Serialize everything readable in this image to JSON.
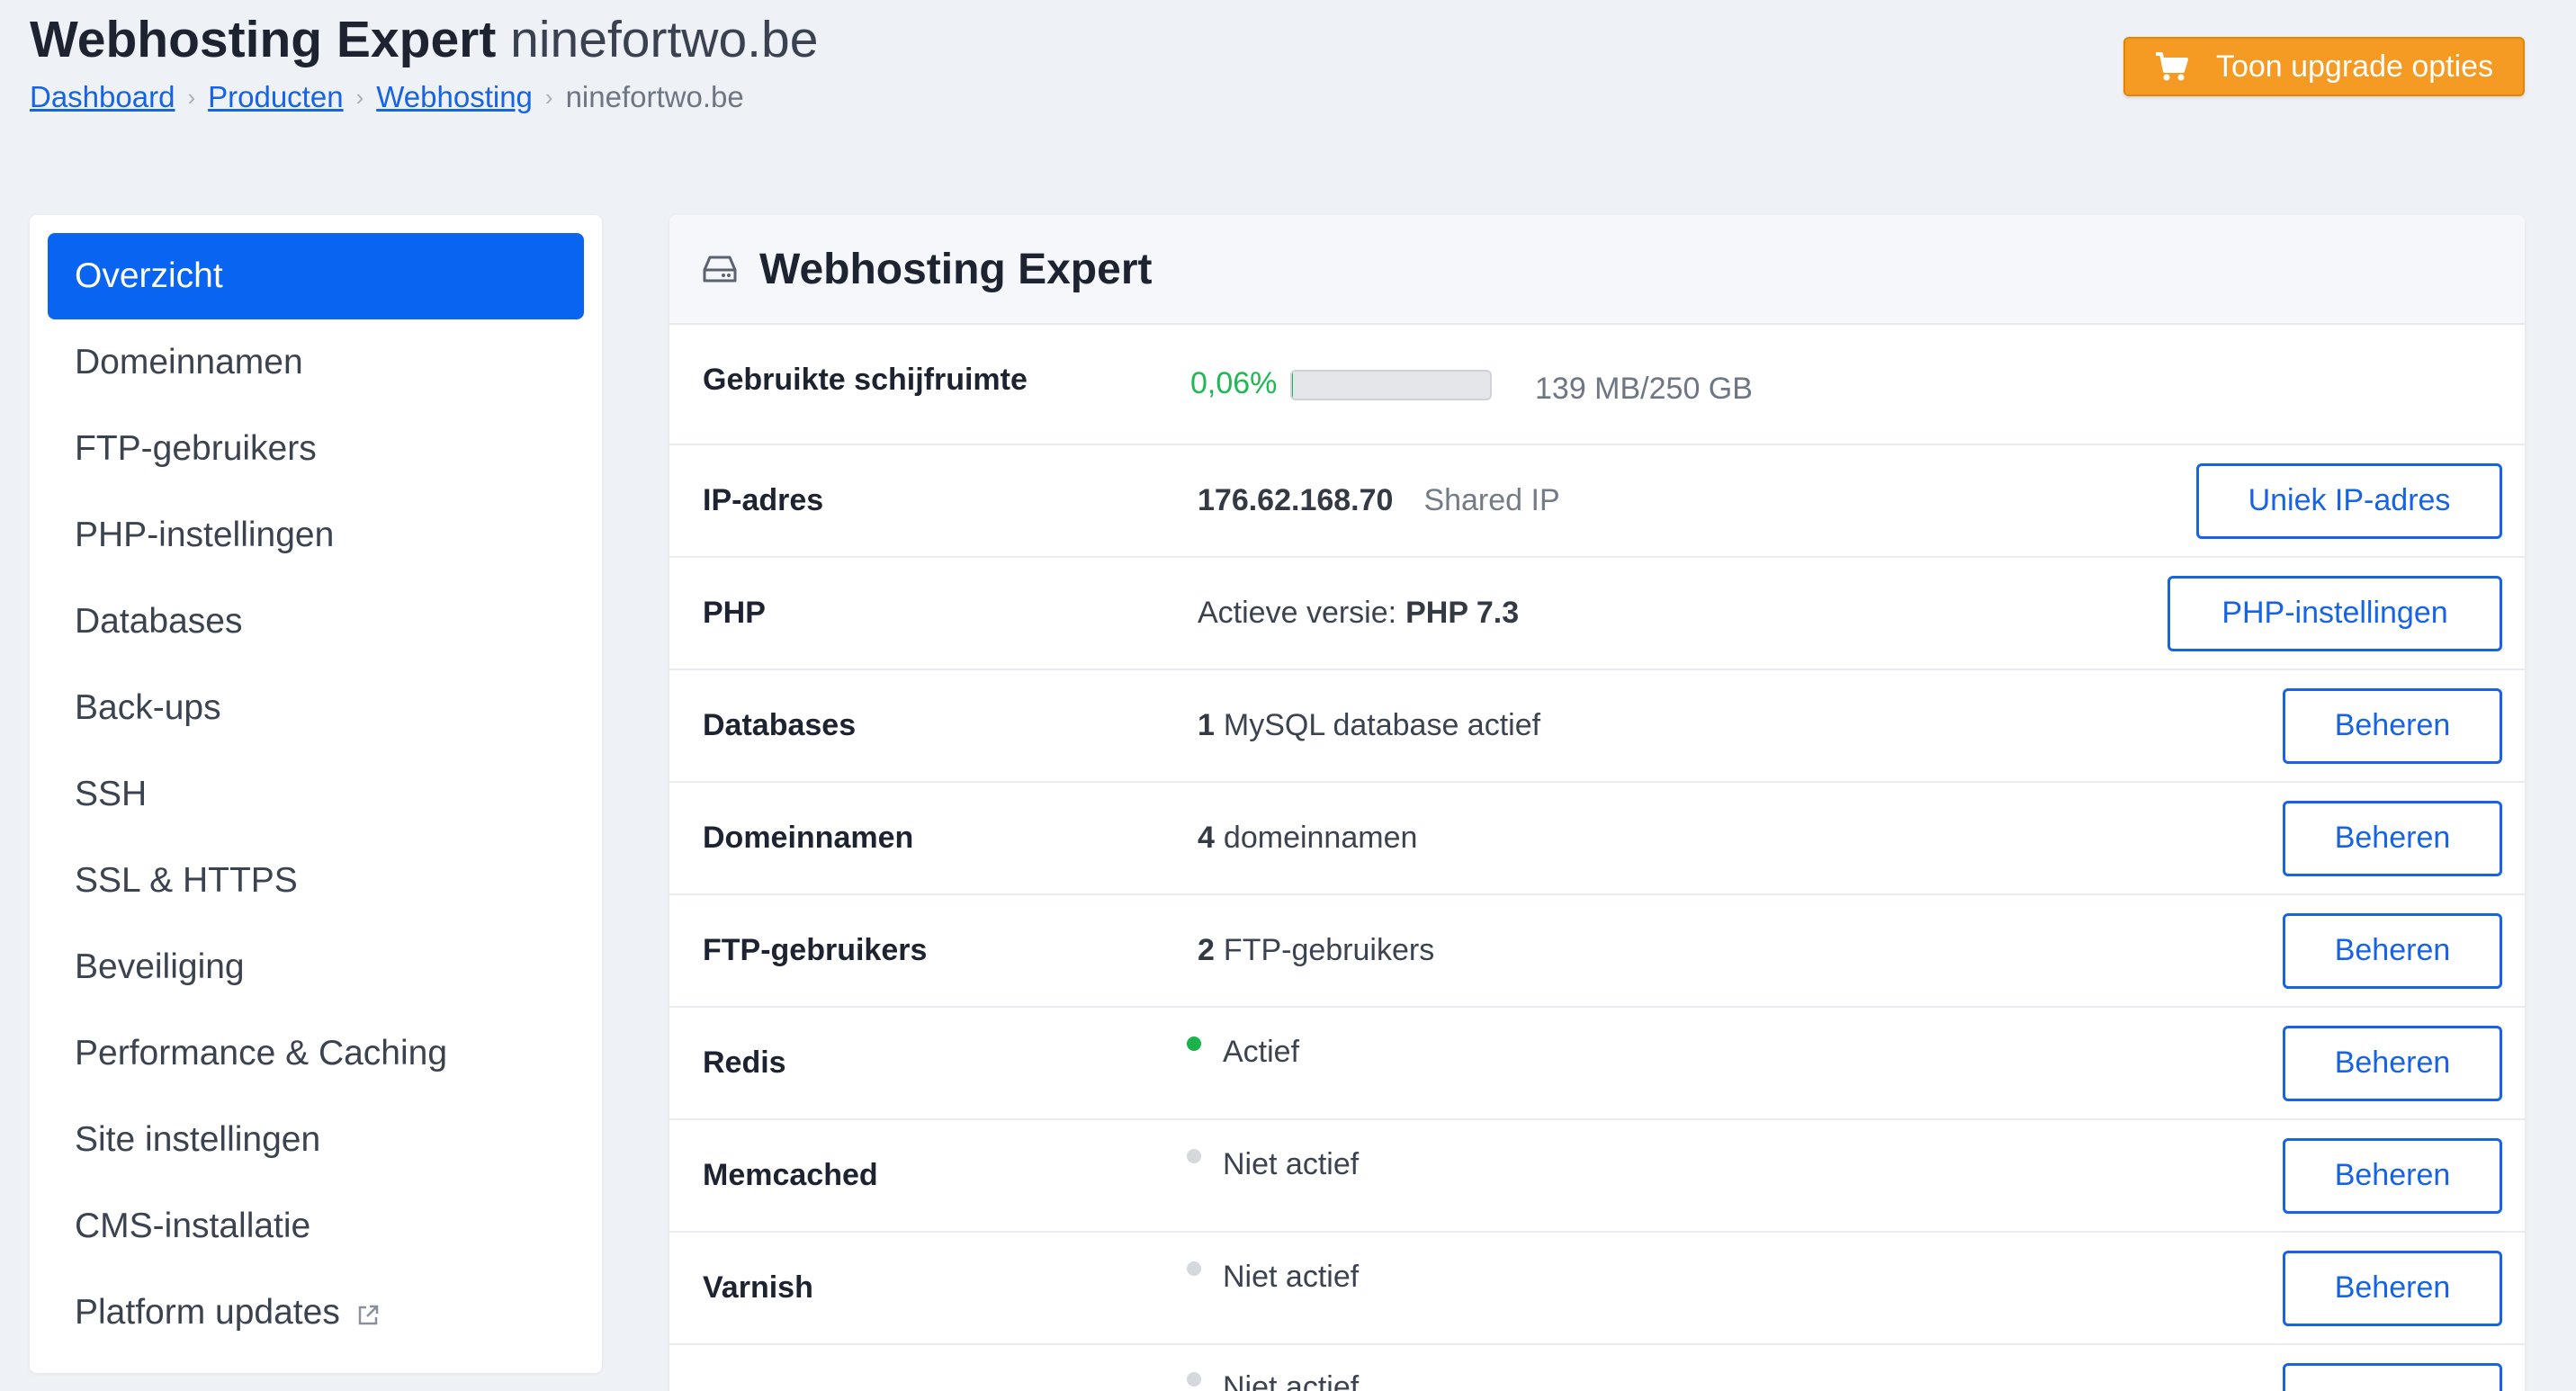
{
  "header": {
    "title_main": "Webhosting Expert",
    "title_domain": "ninefortwo.be",
    "breadcrumb": [
      "Dashboard",
      "Producten",
      "Webhosting",
      "ninefortwo.be"
    ],
    "upgrade_label": "Toon upgrade opties"
  },
  "sidebar": {
    "items": [
      {
        "label": "Overzicht",
        "active": true
      },
      {
        "label": "Domeinnamen"
      },
      {
        "label": "FTP-gebruikers"
      },
      {
        "label": "PHP-instellingen"
      },
      {
        "label": "Databases"
      },
      {
        "label": "Back-ups"
      },
      {
        "label": "SSH"
      },
      {
        "label": "SSL & HTTPS"
      },
      {
        "label": "Beveiliging"
      },
      {
        "label": "Performance & Caching"
      },
      {
        "label": "Site instellingen"
      },
      {
        "label": "CMS-installatie"
      },
      {
        "label": "Platform updates",
        "icon": "external-link-icon"
      }
    ]
  },
  "card": {
    "title": "Webhosting Expert",
    "icon": "hard-drive-icon",
    "disk": {
      "label": "Gebruikte schijfruimte",
      "percent": "0,06%",
      "fraction": 0.0006,
      "usage": "139 MB/250 GB"
    },
    "ip": {
      "label": "IP-adres",
      "address": "176.62.168.70",
      "type": "Shared IP",
      "button": "Uniek IP-adres"
    },
    "php": {
      "label": "PHP",
      "prefix": "Actieve versie:",
      "version": "PHP 7.3",
      "button": "PHP-instellingen"
    },
    "databases": {
      "label": "Databases",
      "count": "1",
      "text": "MySQL database actief",
      "button": "Beheren"
    },
    "domains": {
      "label": "Domeinnamen",
      "count": "4",
      "text": "domeinnamen",
      "button": "Beheren"
    },
    "ftp": {
      "label": "FTP-gebruikers",
      "count": "2",
      "text": "FTP-gebruikers",
      "button": "Beheren"
    },
    "redis": {
      "label": "Redis",
      "status": "Actief",
      "status_color": "#1ab24a",
      "button": "Beheren"
    },
    "memcached": {
      "label": "Memcached",
      "status": "Niet actief",
      "status_color": "#d5d8dd",
      "button": "Beheren"
    },
    "varnish": {
      "label": "Varnish",
      "status": "Niet actief",
      "status_color": "#d5d8dd",
      "button": "Beheren"
    },
    "extra": {
      "status": "Niet actief"
    }
  },
  "colors": {
    "accent": "#0a64f2",
    "link": "#1763e6",
    "upgrade": "#f59a23",
    "success": "#1db954"
  }
}
